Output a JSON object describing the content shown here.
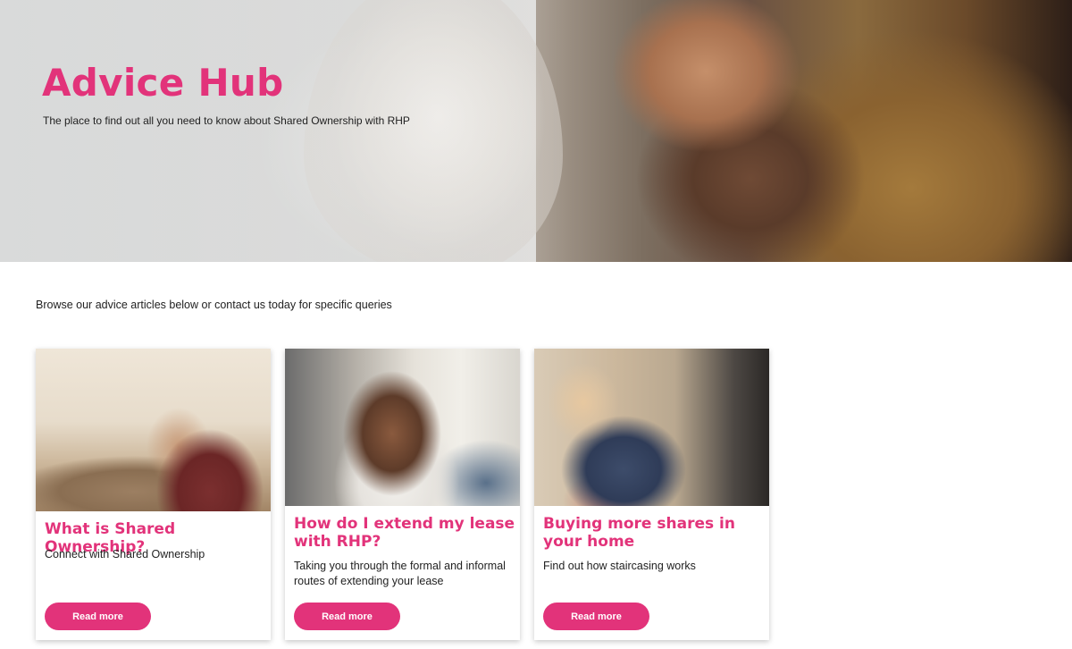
{
  "hero": {
    "title": "Advice Hub",
    "subtitle": "The place to find out all you need to know about Shared Ownership with RHP"
  },
  "intro": {
    "text": "Browse our advice articles below or contact us today for specific queries"
  },
  "cards": [
    {
      "title": "What is Shared Ownership?",
      "description": "Connect with Shared Ownership",
      "button_label": "Read more"
    },
    {
      "title": "How do I extend my lease with RHP?",
      "description": "Taking you through the formal and informal routes of extending your lease",
      "button_label": "Read more"
    },
    {
      "title": "Buying more shares in your home",
      "description": "Find out how staircasing works",
      "button_label": "Read more"
    }
  ],
  "colors": {
    "accent": "#e2337a",
    "text": "#222222",
    "background": "#ffffff"
  }
}
